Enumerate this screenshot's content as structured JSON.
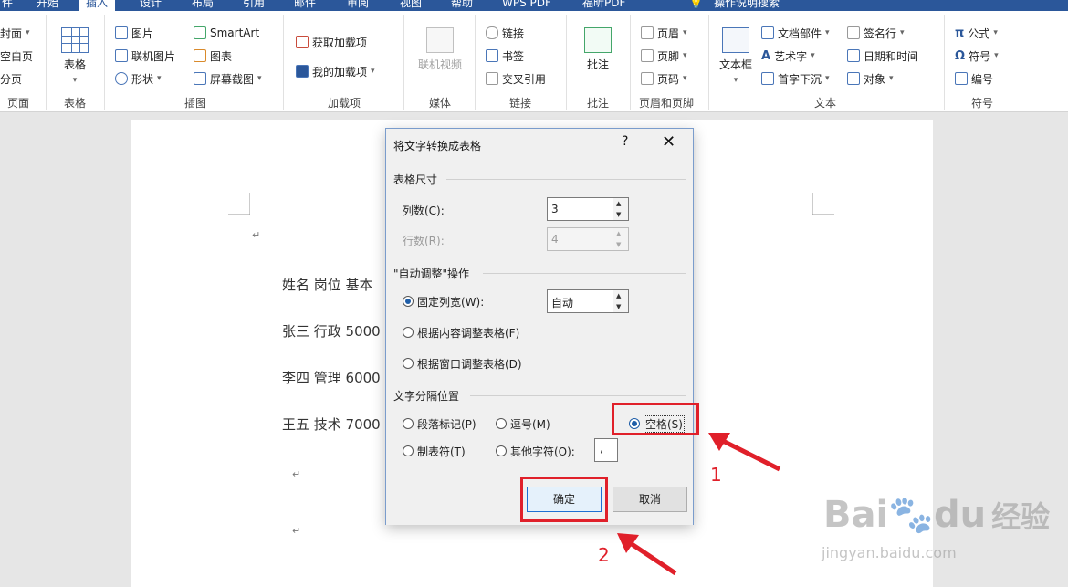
{
  "ribbon_tabs": [
    "件",
    "开始",
    "插入",
    "设计",
    "布局",
    "引用",
    "邮件",
    "审阅",
    "视图",
    "帮助",
    "WPS PDF",
    "福昕PDF",
    "操作说明搜索"
  ],
  "ribbon": {
    "pages_group": {
      "items": [
        "封面",
        "空白页",
        "分页"
      ],
      "label": "页面"
    },
    "table_group": {
      "button": "表格",
      "label": "表格"
    },
    "illustrations_group": {
      "items": [
        "图片",
        "联机图片",
        "形状",
        "SmartArt",
        "图表",
        "屏幕截图"
      ],
      "label": "插图"
    },
    "addins_group": {
      "items": [
        "获取加载项",
        "我的加载项"
      ],
      "label": "加载项"
    },
    "media_group": {
      "button": "联机视频",
      "label": "媒体"
    },
    "links_group": {
      "items": [
        "链接",
        "书签",
        "交叉引用"
      ],
      "label": "链接"
    },
    "comments_group": {
      "button": "批注",
      "label": "批注"
    },
    "header_footer_group": {
      "items": [
        "页眉",
        "页脚",
        "页码"
      ],
      "label": "页眉和页脚"
    },
    "text_group": {
      "textbox": "文本框",
      "items": [
        "文档部件",
        "艺术字",
        "首字下沉",
        "签名行",
        "日期和时间",
        "对象"
      ],
      "label": "文本"
    },
    "symbols_group": {
      "items": [
        "公式",
        "符号",
        "编号"
      ],
      "label": "符号"
    }
  },
  "document": {
    "lines": [
      "姓名 岗位 基本",
      "张三 行政 5000",
      "李四 管理 6000",
      "王五 技术 7000"
    ],
    "para_mark": "↵"
  },
  "dialog": {
    "title": "将文字转换成表格",
    "help": "?",
    "close": "✕",
    "table_size": {
      "heading": "表格尺寸",
      "columns_label": "列数(C):",
      "columns_value": "3",
      "rows_label": "行数(R):",
      "rows_value": "4"
    },
    "autofit": {
      "heading": "\"自动调整\"操作",
      "fixed_label": "固定列宽(W):",
      "fixed_value": "自动",
      "content_label": "根据内容调整表格(F)",
      "window_label": "根据窗口调整表格(D)",
      "selected": "fixed"
    },
    "separator": {
      "heading": "文字分隔位置",
      "paragraph_label": "段落标记(P)",
      "comma_label": "逗号(M)",
      "space_label": "空格(S)",
      "tab_label": "制表符(T)",
      "other_label": "其他字符(O):",
      "other_value": ",",
      "selected": "space"
    },
    "ok_label": "确定",
    "cancel_label": "取消"
  },
  "annotations": {
    "step1": "1",
    "step2": "2",
    "highlight_color": "#e0202a"
  },
  "watermark": {
    "brand": "Bai",
    "brand2": "du",
    "cn": "经验",
    "url": "jingyan.baidu.com"
  },
  "colors": {
    "ribbon_blue": "#2b579a",
    "accent": "#1f6fd1"
  }
}
